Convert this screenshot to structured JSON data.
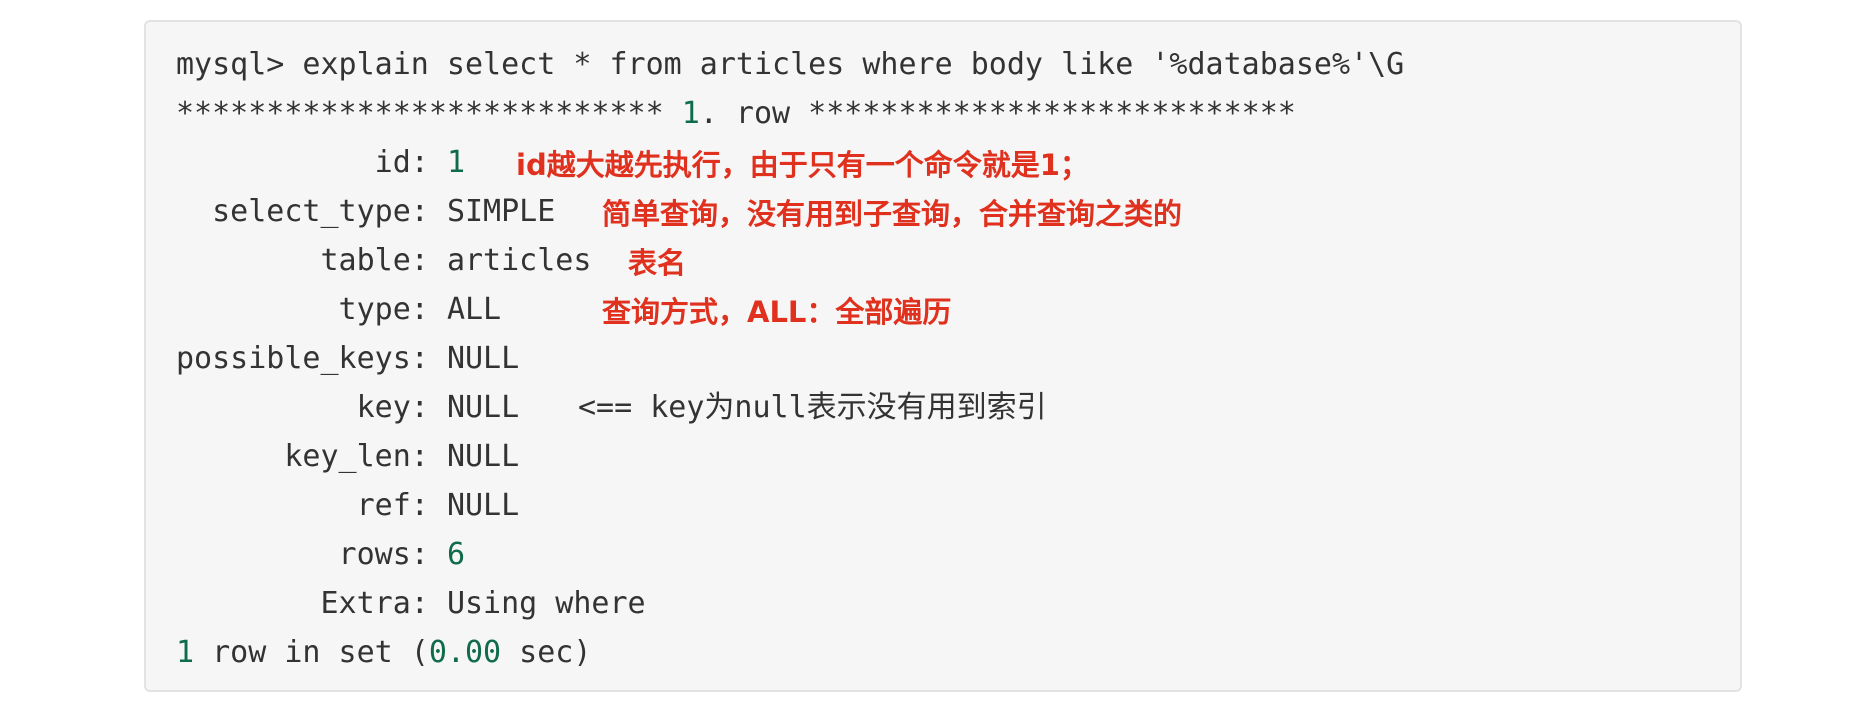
{
  "command": "mysql> explain select * from articles where body like '%database%'\\G",
  "separator": {
    "left": "***************************",
    "row_number": "1",
    "row_text": ". row ",
    "right": "***************************"
  },
  "fields": [
    {
      "name": "           id: ",
      "value": "1"
    },
    {
      "name": "  select_type: ",
      "value": "SIMPLE"
    },
    {
      "name": "        table: ",
      "value": "articles"
    },
    {
      "name": "         type: ",
      "value": "ALL"
    },
    {
      "name": "possible_keys: ",
      "value": "NULL"
    },
    {
      "name": "          key: ",
      "value": "NULL"
    },
    {
      "name": "      key_len: ",
      "value": "NULL"
    },
    {
      "name": "          ref: ",
      "value": "NULL"
    },
    {
      "name": "         rows: ",
      "value": "6"
    },
    {
      "name": "        Extra: ",
      "value": "Using where"
    }
  ],
  "footer": {
    "count": "1",
    "text_mid": " row in set (",
    "time": "0.00",
    "text_end": " sec)"
  },
  "annotations": {
    "id": "id越大越先执行，由于只有一个命令就是1；",
    "select_type": "简单查询，没有用到子查询，合并查询之类的",
    "table": "表名",
    "type": "查询方式，ALL：全部遍历",
    "key": "<== key为null表示没有用到索引"
  },
  "colors": {
    "background": "#f6f6f6",
    "border": "#e3e3e3",
    "text": "#333333",
    "number": "#0f6b4a",
    "annotation": "#e0301e"
  }
}
